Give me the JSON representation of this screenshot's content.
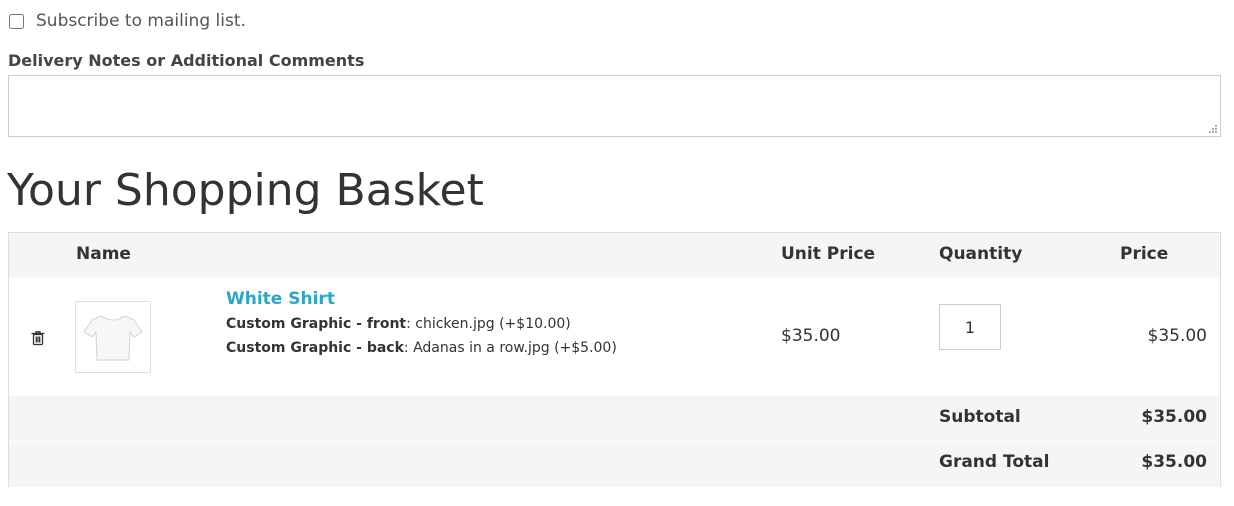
{
  "subscribe": {
    "label": "Subscribe to mailing list.",
    "checked": false
  },
  "notes": {
    "label": "Delivery Notes or Additional Comments",
    "value": ""
  },
  "basket": {
    "title": "Your Shopping Basket",
    "columns": {
      "name": "Name",
      "unit_price": "Unit Price",
      "quantity": "Quantity",
      "price": "Price"
    },
    "items": [
      {
        "name": "White Shirt",
        "options": [
          {
            "label": "Custom Graphic - front",
            "value": ": chicken.jpg (+$10.00)"
          },
          {
            "label": "Custom Graphic - back",
            "value": ": Adanas in a row.jpg (+$5.00)"
          }
        ],
        "unit_price": "$35.00",
        "quantity": "1",
        "price": "$35.00"
      }
    ],
    "subtotal_label": "Subtotal",
    "subtotal_value": "$35.00",
    "grand_total_label": "Grand Total",
    "grand_total_value": "$35.00"
  },
  "icons": {
    "delete": "trash-icon",
    "thumbnail": "tshirt-icon",
    "grip": "resize-grip-icon"
  },
  "colors": {
    "link": "#2ba6cb",
    "band": "#f5f5f5",
    "text": "#333333"
  }
}
